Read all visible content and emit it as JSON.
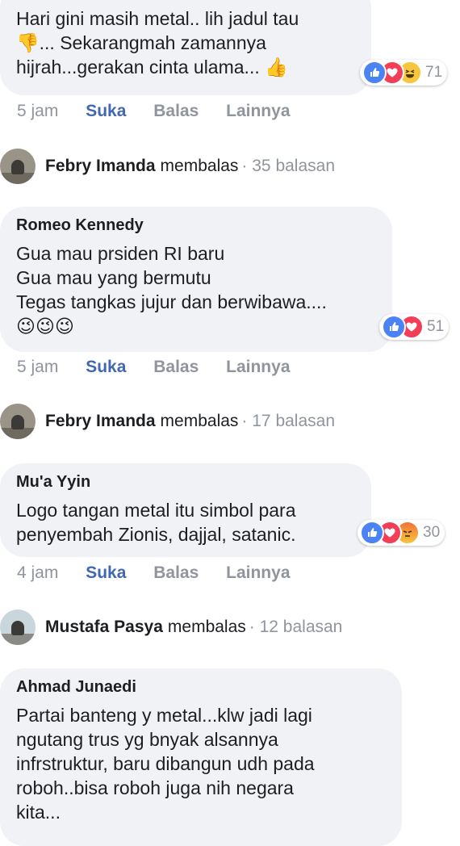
{
  "comments": [
    {
      "author": "",
      "text": "Hari gini masih metal.. lih jadul tau\n👎... Sekarangmah zamannya\nhijrah...gerakan cinta ulama... 👍",
      "reaction_count": "71",
      "time": "5 jam",
      "like": "Suka",
      "reply": "Balas",
      "more": "Lainnya"
    },
    {
      "author": "Romeo Kennedy",
      "text": "Gua mau prsiden RI baru\nGua mau yang bermutu\nTegas tangkas jujur dan berwibawa....\n😉😉😉",
      "reaction_count": "51",
      "time": "5 jam",
      "like": "Suka",
      "reply": "Balas",
      "more": "Lainnya"
    },
    {
      "author": "Mu'a Yyin",
      "text": "Logo tangan metal itu simbol para\npenyembah Zionis, dajjal, satanic.",
      "reaction_count": "30",
      "time": "4 jam",
      "like": "Suka",
      "reply": "Balas",
      "more": "Lainnya"
    },
    {
      "author": "Ahmad Junaedi",
      "text": "Partai banteng y metal...klw jadi lagi\nngutang trus yg bnyak alsannya\ninfrstruktur, baru dibangun udh pada\nroboh..bisa roboh juga nih negara\nkita..."
    }
  ],
  "replies": [
    {
      "name": "Febry Imanda",
      "verb": "membalas",
      "count": "· 35 balasan"
    },
    {
      "name": "Febry Imanda",
      "verb": "membalas",
      "count": "· 17 balasan"
    },
    {
      "name": "Mustafa Pasya",
      "verb": "membalas",
      "count": "· 12 balasan"
    }
  ],
  "colors": {
    "like_blue": "#4267b2",
    "bubble_bg": "#f0f2f5",
    "meta_grey": "#90949c"
  }
}
